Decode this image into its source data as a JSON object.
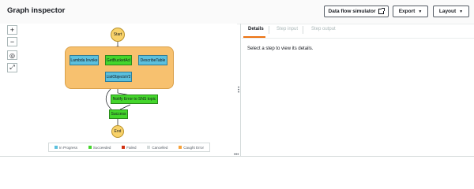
{
  "header": {
    "title": "Graph inspector",
    "data_flow_label": "Data flow simulator",
    "export_label": "Export",
    "layout_label": "Layout"
  },
  "zoom": {
    "zoom_in": "+",
    "zoom_out": "−",
    "center": "◎",
    "fit": "⤢"
  },
  "graph": {
    "start": "Start",
    "end": "End",
    "parallel_nodes": [
      "Lambda Invoke",
      "GetBucketAcl",
      "DescribeTable"
    ],
    "list_objects": "ListObjectsV2",
    "notify": "Notify Error to SNS topic",
    "success": "Success"
  },
  "legend": {
    "items": [
      {
        "label": "In Progress",
        "color": "#5bc0de"
      },
      {
        "label": "Succeeded",
        "color": "#44d62c"
      },
      {
        "label": "Failed",
        "color": "#d13212"
      },
      {
        "label": "Cancelled",
        "color": "#d5dbdb"
      },
      {
        "label": "Caught Error",
        "color": "#f7a23a"
      }
    ]
  },
  "tabs": [
    {
      "label": "Details",
      "active": true
    },
    {
      "label": "Step input",
      "active": false
    },
    {
      "label": "Step output",
      "active": false
    }
  ],
  "details": {
    "message": "Select a step to view its details."
  }
}
